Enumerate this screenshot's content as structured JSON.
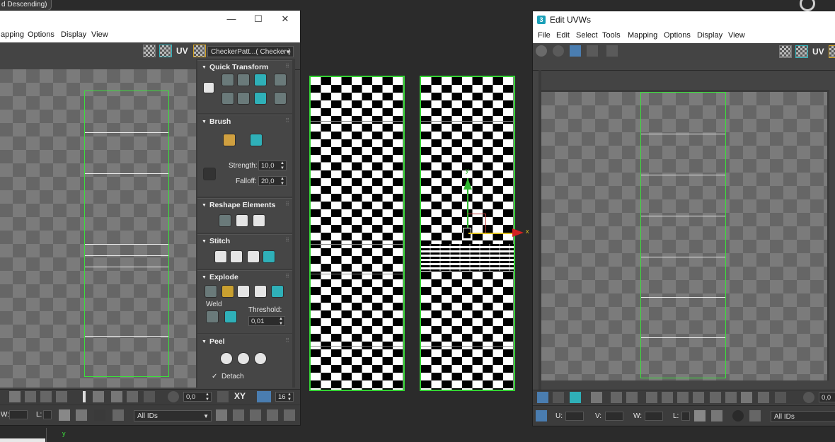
{
  "top_label": "d Descending)",
  "left_window": {
    "menu": [
      "apping",
      "Options",
      "Display",
      "View"
    ],
    "uv_text": "UV",
    "checker_dropdown": "CheckerPatt...( Checker )",
    "rollouts": {
      "quick_transform": "Quick Transform",
      "brush": "Brush",
      "strength_label": "Strength:",
      "strength_value": "10,0",
      "falloff_label": "Falloff:",
      "falloff_value": "20,0",
      "reshape": "Reshape Elements",
      "stitch": "Stitch",
      "explode": "Explode",
      "weld_label": "Weld",
      "threshold_label": "Threshold:",
      "threshold_value": "0,01",
      "peel": "Peel",
      "detach_label": "Detach"
    },
    "status": {
      "angle_value": "0,0",
      "xy_label": "XY",
      "snap_value": "16",
      "w_label": "W:",
      "l_label": "L:",
      "ids_dropdown": "All IDs"
    }
  },
  "center": {
    "axis_y": "y",
    "axis_x": "x",
    "bottom_axis_y": "y"
  },
  "right_window": {
    "title": "Edit UVWs",
    "app_icon": "3",
    "menu": [
      "File",
      "Edit",
      "Select",
      "Tools",
      "Mapping",
      "Options",
      "Display",
      "View"
    ],
    "uv_text": "UV",
    "status": {
      "value": "0,0",
      "u_label": "U:",
      "v_label": "V:",
      "w_label": "W:",
      "l_label": "L:",
      "ids_dropdown": "All IDs"
    }
  }
}
